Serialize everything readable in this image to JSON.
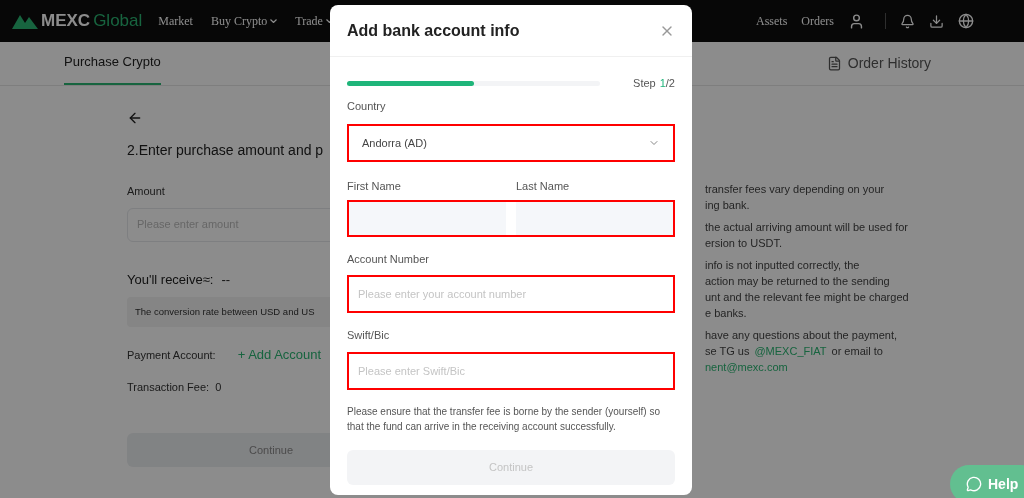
{
  "navbar": {
    "logo": {
      "brand": "MEXC",
      "suffix": "Global"
    },
    "menu": [
      {
        "label": "Market",
        "dropdown": false
      },
      {
        "label": "Buy Crypto",
        "dropdown": true
      },
      {
        "label": "Trade",
        "dropdown": true
      }
    ],
    "right_links": [
      "Assets",
      "Orders"
    ]
  },
  "subnav": {
    "tabs": [
      {
        "label": "Purchase Crypto",
        "selected": true
      }
    ],
    "order_history": "Order History"
  },
  "page": {
    "heading": "2.Enter purchase amount and p",
    "amount_label": "Amount",
    "amount_placeholder": "Please enter amount",
    "receive_label": "You'll receive≈:",
    "receive_value": "--",
    "conversion_note": "The conversion rate between USD and US",
    "payment_label": "Payment Account:",
    "add_account": "+ Add Account",
    "fee_label": "Transaction Fee:",
    "fee_value": "0",
    "continue": "Continue",
    "notes": [
      [
        [
          {
            "kind": "text",
            "text": "transfer fees vary depending on your"
          }
        ],
        [
          {
            "kind": "text",
            "text": "ing bank."
          }
        ]
      ],
      [
        [
          {
            "kind": "text",
            "text": "the actual arriving amount will be used for"
          }
        ],
        [
          {
            "kind": "text",
            "text": "ersion to USDT."
          }
        ]
      ],
      [
        [
          {
            "kind": "text",
            "text": "info is not inputted correctly, the"
          }
        ],
        [
          {
            "kind": "text",
            "text": "action may be returned to the sending"
          }
        ],
        [
          {
            "kind": "text",
            "text": "unt and the relevant fee might be charged"
          }
        ],
        [
          {
            "kind": "text",
            "text": "e banks."
          }
        ]
      ],
      [
        [
          {
            "kind": "text",
            "text": "have any questions about the payment,"
          }
        ],
        [
          {
            "kind": "text",
            "text": "se TG us"
          },
          {
            "kind": "link",
            "text": "@MEXC_FIAT"
          },
          {
            "kind": "text",
            "text": "or email to"
          }
        ],
        [
          {
            "kind": "link",
            "text": "nent@mexc.com"
          }
        ]
      ]
    ]
  },
  "modal": {
    "title": "Add bank account info",
    "progress": {
      "level": 0.5
    },
    "step_label": "Step",
    "step_current": "1",
    "step_total": "/2",
    "country": {
      "label": "Country",
      "value": "Andorra (AD)",
      "highlighted": true
    },
    "name_fields": {
      "first_label": "First Name",
      "last_label": "Last Name",
      "highlighted": true
    },
    "fields": [
      {
        "label": "Account Number",
        "placeholder": "Please enter your account number",
        "highlighted": true
      },
      {
        "label": "Swift/Bic",
        "placeholder": "Please enter Swift/Bic",
        "highlighted": true
      }
    ],
    "notice": "Please ensure that the transfer fee is borne by the sender (yourself) so that the fund can arrive in the receiving account successfully.",
    "continue": {
      "label": "Continue",
      "disabled": true
    }
  },
  "help": {
    "label": "Help"
  }
}
